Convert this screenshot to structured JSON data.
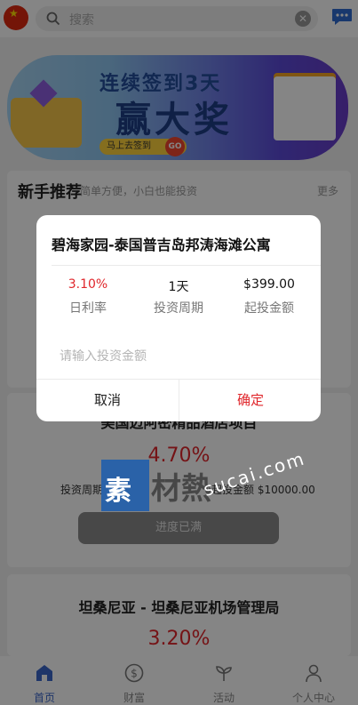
{
  "header": {
    "search_placeholder": "搜索",
    "clear_glyph": "✕",
    "colors": {
      "flag": "#de2910",
      "msg": "#2f6bd1"
    }
  },
  "banner": {
    "line1": "连续签到3天",
    "line2": "赢大奖",
    "pill_text": "马上去签到",
    "go_text": "GO"
  },
  "section": {
    "title": "新手推荐",
    "subtitle": "简单方便，小白也能投资",
    "more": "更多"
  },
  "cards": [
    {
      "title": "美国迈阿密精品酒店项目",
      "rate": "4.70%",
      "period_label": "投资周期",
      "min_label": "起投金额",
      "min_value": "$10000.00",
      "button": "进度已满"
    },
    {
      "title": "坦桑尼亚 - 坦桑尼亚机场管理局",
      "rate": "3.20%"
    }
  ],
  "tabbar": {
    "items": [
      {
        "label": "首页",
        "icon": "home-icon",
        "active": true
      },
      {
        "label": "财富",
        "icon": "dollar-icon",
        "active": false
      },
      {
        "label": "活动",
        "icon": "sprout-icon",
        "active": false
      },
      {
        "label": "个人中心",
        "icon": "user-icon",
        "active": false
      }
    ]
  },
  "modal": {
    "title": "碧海家园-泰国普吉岛邦涛海滩公寓",
    "stats": [
      {
        "value": "3.10%",
        "label": "日利率"
      },
      {
        "value": "1天",
        "label": "投资周期"
      },
      {
        "value": "$399.00",
        "label": "起投金额"
      }
    ],
    "amount_placeholder": "请输入投资金额",
    "cancel": "取消",
    "confirm": "确定",
    "accent": "#e0262b"
  },
  "watermark": {
    "box_text": "素",
    "text": "材熱",
    "url": "sucai.com"
  }
}
